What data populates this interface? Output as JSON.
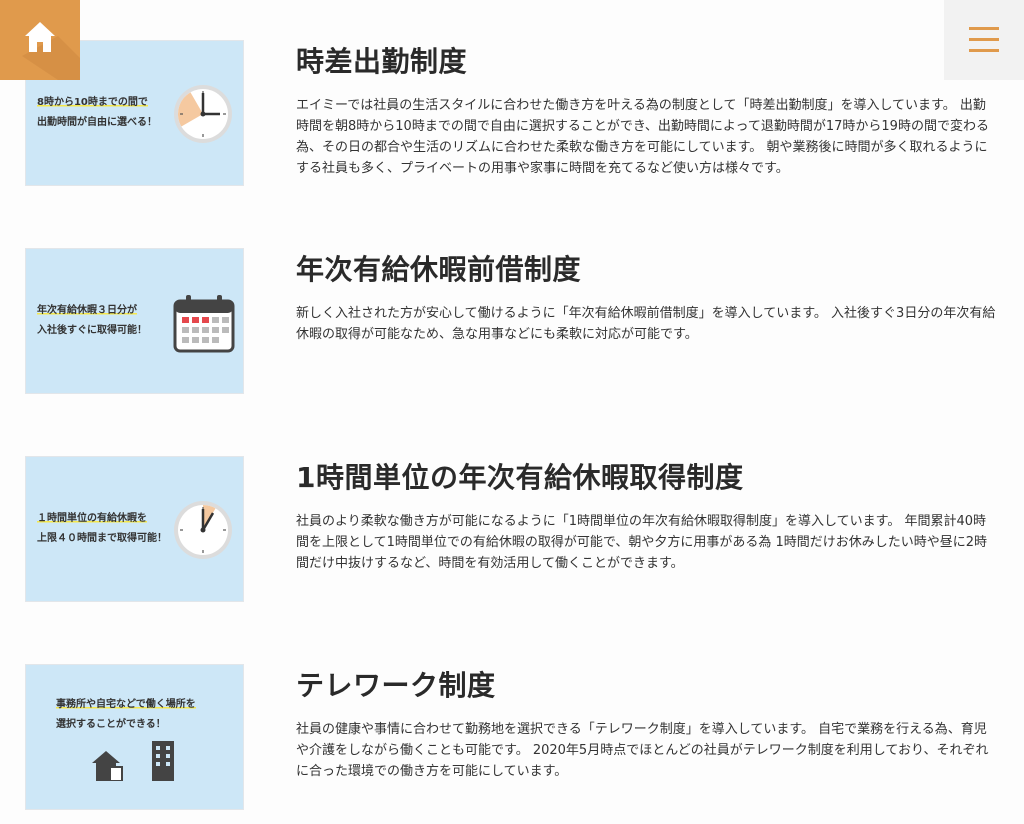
{
  "nav": {
    "home_icon": "home-icon",
    "menu_icon": "hamburger-menu-icon"
  },
  "sections": [
    {
      "title": "時差出勤制度",
      "image_caption": [
        "8時から10時までの間で",
        "出勤時間が自由に選べる！"
      ],
      "image_icon": "clock-icon",
      "description": "エイミーでは社員の生活スタイルに合わせた働き方を叶える為の制度として「時差出勤制度」を導入しています。 出勤時間を朝8時から10時までの間で自由に選択することができ、出勤時間によって退勤時間が17時から19時の間で変わる為、その日の都合や生活のリズムに合わせた柔軟な働き方を可能にしています。 朝や業務後に時間が多く取れるようにする社員も多く、プライベートの用事や家事に時間を充てるなど使い方は様々です。"
    },
    {
      "title": "年次有給休暇前借制度",
      "image_caption": [
        "年次有給休暇３日分が",
        "入社後すぐに取得可能！"
      ],
      "image_icon": "calendar-icon",
      "description": "新しく入社された方が安心して働けるように「年次有給休暇前借制度」を導入しています。 入社後すぐ3日分の年次有給休暇の取得が可能なため、急な用事などにも柔軟に対応が可能です。"
    },
    {
      "title": "1時間単位の年次有給休暇取得制度",
      "image_caption": [
        "１時間単位の有給休暇を",
        "上限４０時間まで取得可能！"
      ],
      "image_icon": "clock-icon",
      "description": "社員のより柔軟な働き方が可能になるように「1時間単位の年次有給休暇取得制度」を導入しています。 年間累計40時間を上限として1時間単位での有給休暇の取得が可能で、朝や夕方に用事がある為 1時間だけお休みしたい時や昼に2時間だけ中抜けするなど、時間を有効活用して働くことができます。"
    },
    {
      "title": "テレワーク制度",
      "image_caption": [
        "事務所や自宅などで働く場所を",
        "選択することができる！"
      ],
      "image_icon": "house-building-icon",
      "description": "社員の健康や事情に合わせて勤務地を選択できる「テレワーク制度」を導入しています。 自宅で業務を行える為、育児や介護をしながら働くことも可能です。 2020年5月時点でほとんどの社員がテレワーク制度を利用しており、それぞれに合った環境での働き方を可能にしています。"
    }
  ]
}
